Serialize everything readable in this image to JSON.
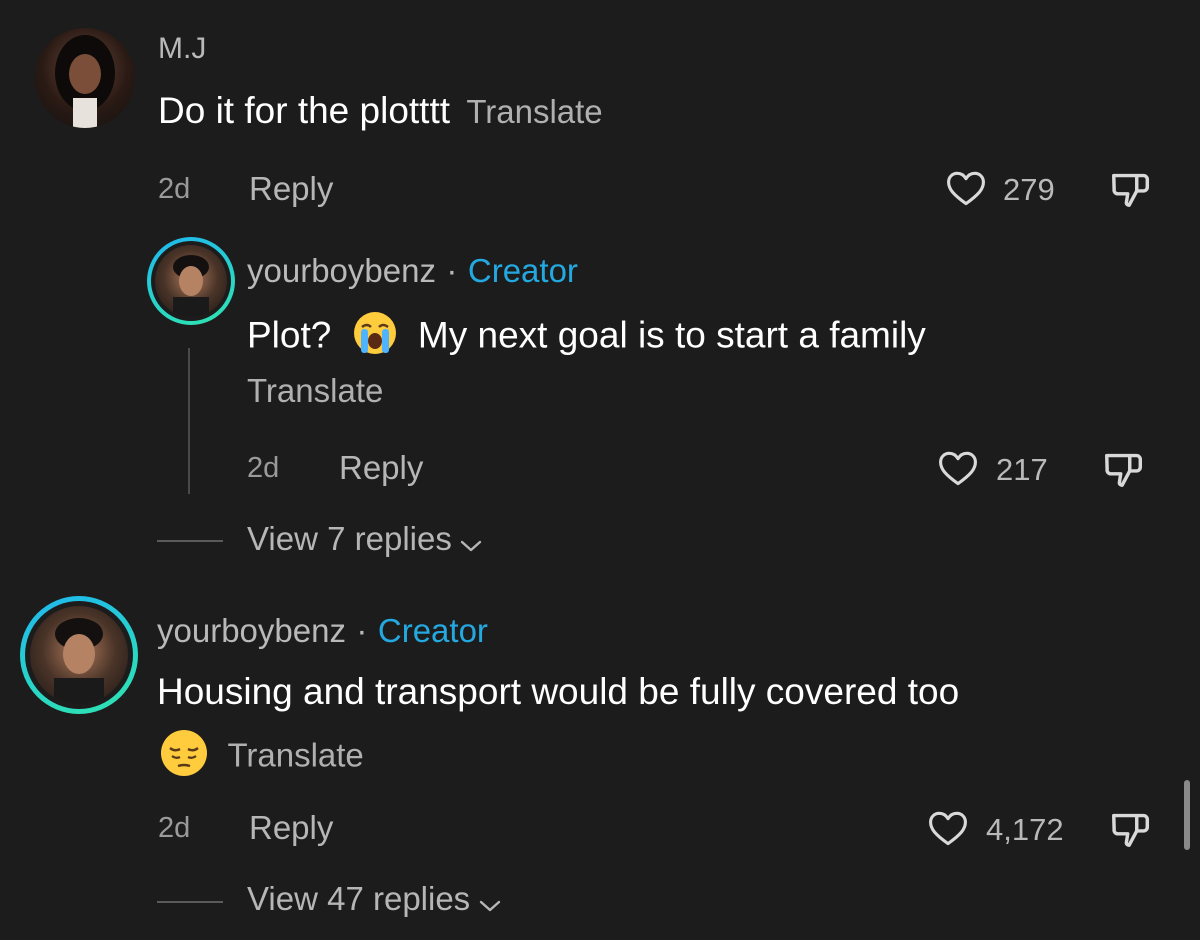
{
  "comments": [
    {
      "username": "M.J",
      "text": "Do it for the plotttt",
      "translate": "Translate",
      "time": "2d",
      "reply_label": "Reply",
      "likes": "279"
    }
  ],
  "reply": {
    "username": "yourboybenz",
    "separator": "·",
    "badge": "Creator",
    "text_before": "Plot?",
    "text_emoji": "loudly-crying-face",
    "text_after": "My next goal is to start a family",
    "translate": "Translate",
    "time": "2d",
    "reply_label": "Reply",
    "likes": "217",
    "view_replies": "View 7 replies"
  },
  "creator_comment": {
    "username": "yourboybenz",
    "separator": "·",
    "badge": "Creator",
    "text_line1": "Housing and transport would be fully covered too",
    "text_emoji": "pensive-face",
    "translate": "Translate",
    "time": "2d",
    "reply_label": "Reply",
    "likes": "4,172",
    "view_replies": "View 47 replies"
  },
  "colors": {
    "background": "#1c1c1c",
    "creator_badge": "#24a8e0",
    "avatar_ring": "#29d6c6"
  },
  "icons": [
    "heart-outline-icon",
    "dislike-icon",
    "chevron-down-icon"
  ]
}
